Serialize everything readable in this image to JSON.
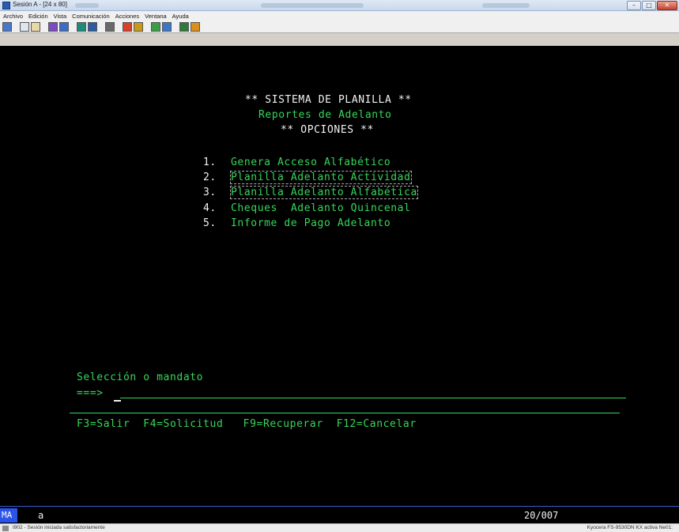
{
  "window": {
    "title": "Sesión A - [24 x 80]"
  },
  "menu": [
    "Archivo",
    "Edición",
    "Vista",
    "Comunicación",
    "Acciones",
    "Ventana",
    "Ayuda"
  ],
  "screen": {
    "title": "** SISTEMA DE PLANILLA **",
    "subtitle": "Reportes de Adelanto",
    "options_header": "** OPCIONES **",
    "options": [
      {
        "num": "1.",
        "label": "Genera Acceso Alfabético"
      },
      {
        "num": "2.",
        "label": "Planilla Adelanto Actividad"
      },
      {
        "num": "3.",
        "label": "Planilla Adelanto Alfabética"
      },
      {
        "num": "4.",
        "label": "Cheques  Adelanto Quincenal"
      },
      {
        "num": "5.",
        "label": "Informe de Pago Adelanto"
      }
    ],
    "command_label": "Selección o mandato",
    "prompt": "===>",
    "command_value": "",
    "function_keys": "F3=Salir  F4=Solicitud   F9=Recuperar  F12=Cancelar"
  },
  "oia": {
    "mode": "MA",
    "indicator": "a",
    "cursor_position": "20/007"
  },
  "statusbar": {
    "left": "I902 - Sesión iniciada satisfactoriamente",
    "right": "Kyocera FS-9530DN KX activa Ne01:"
  },
  "colors": {
    "terminal_bg": "#000000",
    "field_text": "#36d65a",
    "protected_text": "#f2f2f2",
    "oia_accent": "#2a55e8"
  }
}
